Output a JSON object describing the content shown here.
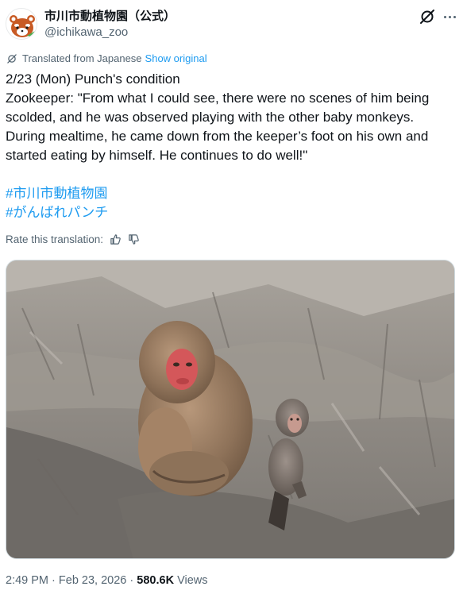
{
  "account": {
    "display_name": "市川市動植物園（公式）",
    "handle": "@ichikawa_zoo",
    "avatar_icon": "red-panda-icon"
  },
  "translation": {
    "label": "Translated from Japanese",
    "show_original": "Show original"
  },
  "tweet": {
    "lines": [
      "2/23 (Mon) Punch's condition",
      "Zookeeper: \"From what I could see, there were no scenes of him being scolded, and he was observed playing with the other baby monkeys. During mealtime, he came down from the keeper’s foot on his own and started eating by himself. He continues to do well!\""
    ],
    "hashtags": [
      "#市川市動植物園",
      "#がんばれパンチ"
    ]
  },
  "rate_translation": {
    "label": "Rate this translation:",
    "thumbs_up_icon": "thumbs-up-icon",
    "thumbs_down_icon": "thumbs-down-icon"
  },
  "media": {
    "alt_subject": "two-macaques-on-rock"
  },
  "meta": {
    "time": "2:49 PM",
    "separator": "·",
    "date": "Feb 23, 2026",
    "views_count": "580.6K",
    "views_label": "Views"
  },
  "colors": {
    "text": "#0f1419",
    "secondary": "#536471",
    "accent": "#1d9bf0"
  }
}
